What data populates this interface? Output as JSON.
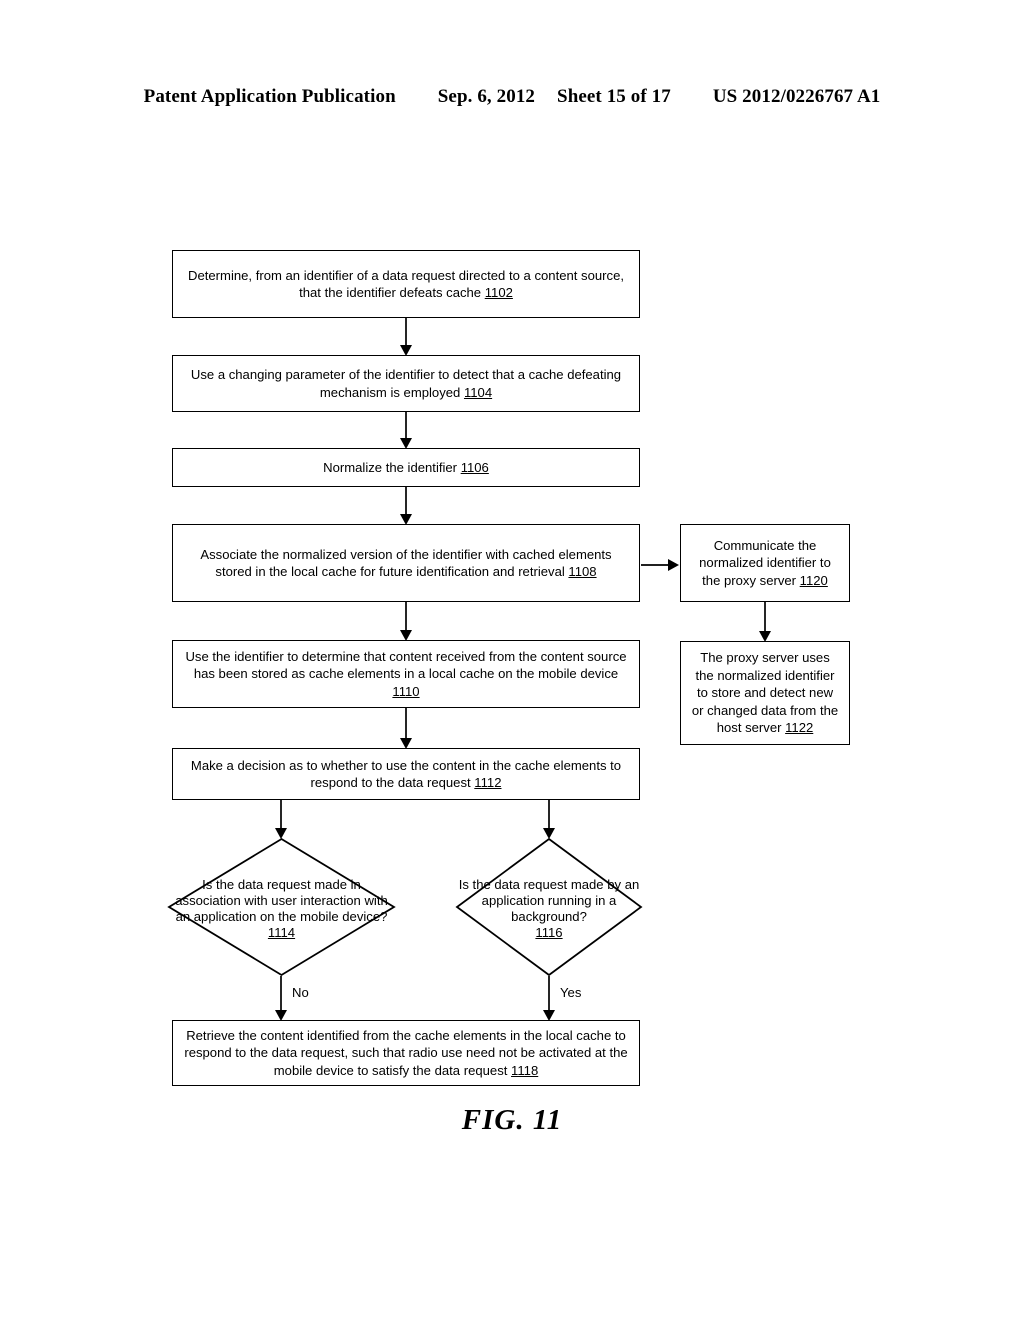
{
  "header": {
    "publication": "Patent Application Publication",
    "date": "Sep. 6, 2012",
    "sheet": "Sheet 15 of 17",
    "patent_number": "US 2012/0226767 A1"
  },
  "figure": {
    "caption": "FIG. 11"
  },
  "nodes": {
    "n1102": {
      "text": "Determine, from an identifier of a data request directed to a content source, that the identifier defeats cache ",
      "ref": "1102"
    },
    "n1104": {
      "text": "Use a changing parameter of the identifier to detect that a cache defeating mechanism is employed ",
      "ref": "1104"
    },
    "n1106": {
      "text": "Normalize the identifier ",
      "ref": "1106"
    },
    "n1108": {
      "text": "Associate the normalized version of the identifier with cached elements stored in the local cache for future identification and retrieval ",
      "ref": "1108"
    },
    "n1110": {
      "text": "Use the identifier to determine that content received from the content source has been stored as cache elements in a local cache on the mobile device ",
      "ref": "1110"
    },
    "n1112": {
      "text": "Make a decision as to whether to use the content in the cache elements to respond to the data request ",
      "ref": "1112"
    },
    "n1114": {
      "text": "Is the data request made in association with user interaction with an application on the mobile device?",
      "ref": "1114"
    },
    "n1116": {
      "text": "Is the data request made by an application running in a background?",
      "ref": "1116"
    },
    "n1118": {
      "text": "Retrieve the content identified from the cache elements in the local cache to respond to the data request, such that radio use need not be activated at the mobile device to satisfy the data request ",
      "ref": "1118"
    },
    "n1120": {
      "text": "Communicate the normalized identifier to the proxy server ",
      "ref": "1120"
    },
    "n1122": {
      "text": "The proxy server uses the normalized identifier to store and detect new or changed data from the host server ",
      "ref": "1122"
    }
  },
  "branch_labels": {
    "no": "No",
    "yes": "Yes"
  },
  "chart_data": {
    "type": "diagram",
    "title": "FIG. 11",
    "diagram_kind": "flowchart",
    "nodes": [
      {
        "id": "1102",
        "shape": "process",
        "label": "Determine, from an identifier of a data request directed to a content source, that the identifier defeats cache 1102"
      },
      {
        "id": "1104",
        "shape": "process",
        "label": "Use a changing parameter of the identifier to detect that a cache defeating mechanism is employed 1104"
      },
      {
        "id": "1106",
        "shape": "process",
        "label": "Normalize the identifier 1106"
      },
      {
        "id": "1108",
        "shape": "process",
        "label": "Associate the normalized version of the identifier with cached elements stored in the local cache for future identification and retrieval 1108"
      },
      {
        "id": "1110",
        "shape": "process",
        "label": "Use the identifier to determine that content received from the content source has been stored as cache elements in a local cache on the mobile device 1110"
      },
      {
        "id": "1112",
        "shape": "process",
        "label": "Make a decision as to whether to use the content in the cache elements to respond to the data request 1112"
      },
      {
        "id": "1114",
        "shape": "decision",
        "label": "Is the data request made in association with user interaction with an application on the mobile device? 1114"
      },
      {
        "id": "1116",
        "shape": "decision",
        "label": "Is the data request made by an application running in a background? 1116"
      },
      {
        "id": "1118",
        "shape": "process",
        "label": "Retrieve the content identified from the cache elements in the local cache to respond to the data request, such that radio use need not be activated at the mobile device to satisfy the data request 1118"
      },
      {
        "id": "1120",
        "shape": "process",
        "label": "Communicate the normalized identifier to the proxy server 1120"
      },
      {
        "id": "1122",
        "shape": "process",
        "label": "The proxy server uses the normalized identifier to store and detect new or changed data from the host server 1122"
      }
    ],
    "edges": [
      {
        "from": "1102",
        "to": "1104",
        "label": ""
      },
      {
        "from": "1104",
        "to": "1106",
        "label": ""
      },
      {
        "from": "1106",
        "to": "1108",
        "label": ""
      },
      {
        "from": "1108",
        "to": "1110",
        "label": ""
      },
      {
        "from": "1108",
        "to": "1120",
        "label": ""
      },
      {
        "from": "1120",
        "to": "1122",
        "label": ""
      },
      {
        "from": "1110",
        "to": "1112",
        "label": ""
      },
      {
        "from": "1112",
        "to": "1114",
        "label": ""
      },
      {
        "from": "1112",
        "to": "1116",
        "label": ""
      },
      {
        "from": "1114",
        "to": "1118",
        "label": "No"
      },
      {
        "from": "1116",
        "to": "1118",
        "label": "Yes"
      }
    ]
  }
}
